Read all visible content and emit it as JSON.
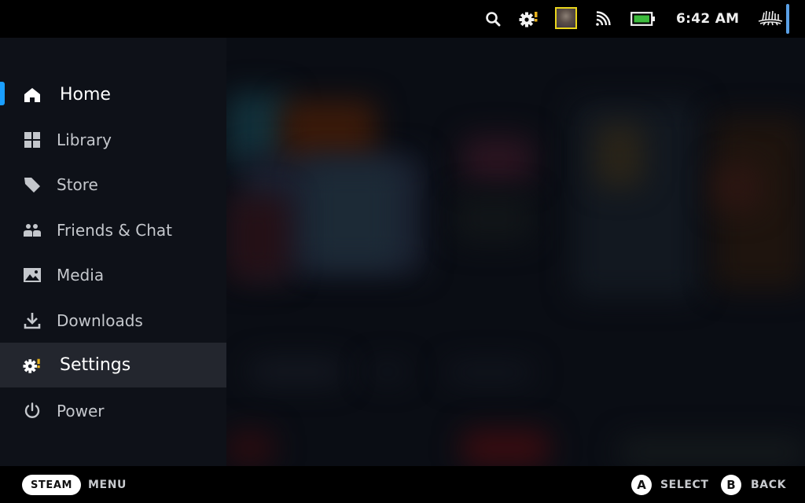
{
  "topbar": {
    "icons": [
      "search-icon",
      "settings-alert-icon",
      "avatar",
      "wifi-icon",
      "battery-icon",
      "profile-icon"
    ],
    "time": "6:42 AM",
    "battery_color": "#3dbb3d",
    "alert_color": "#e8b21d"
  },
  "sidebar": {
    "accent_color": "#1a9fff",
    "items": [
      {
        "label": "Home",
        "icon": "home-icon",
        "focused": true
      },
      {
        "label": "Library",
        "icon": "library-grid-icon"
      },
      {
        "label": "Store",
        "icon": "store-tag-icon"
      },
      {
        "label": "Friends & Chat",
        "icon": "friends-icon"
      },
      {
        "label": "Media",
        "icon": "media-image-icon"
      },
      {
        "label": "Downloads",
        "icon": "download-icon"
      },
      {
        "label": "Settings",
        "icon": "settings-alert-icon",
        "highlighted": true
      },
      {
        "label": "Power",
        "icon": "power-icon"
      }
    ]
  },
  "footer": {
    "steam_label": "STEAM",
    "menu_label": "MENU",
    "a_button": "A",
    "select_label": "SELECT",
    "b_button": "B",
    "back_label": "BACK"
  }
}
